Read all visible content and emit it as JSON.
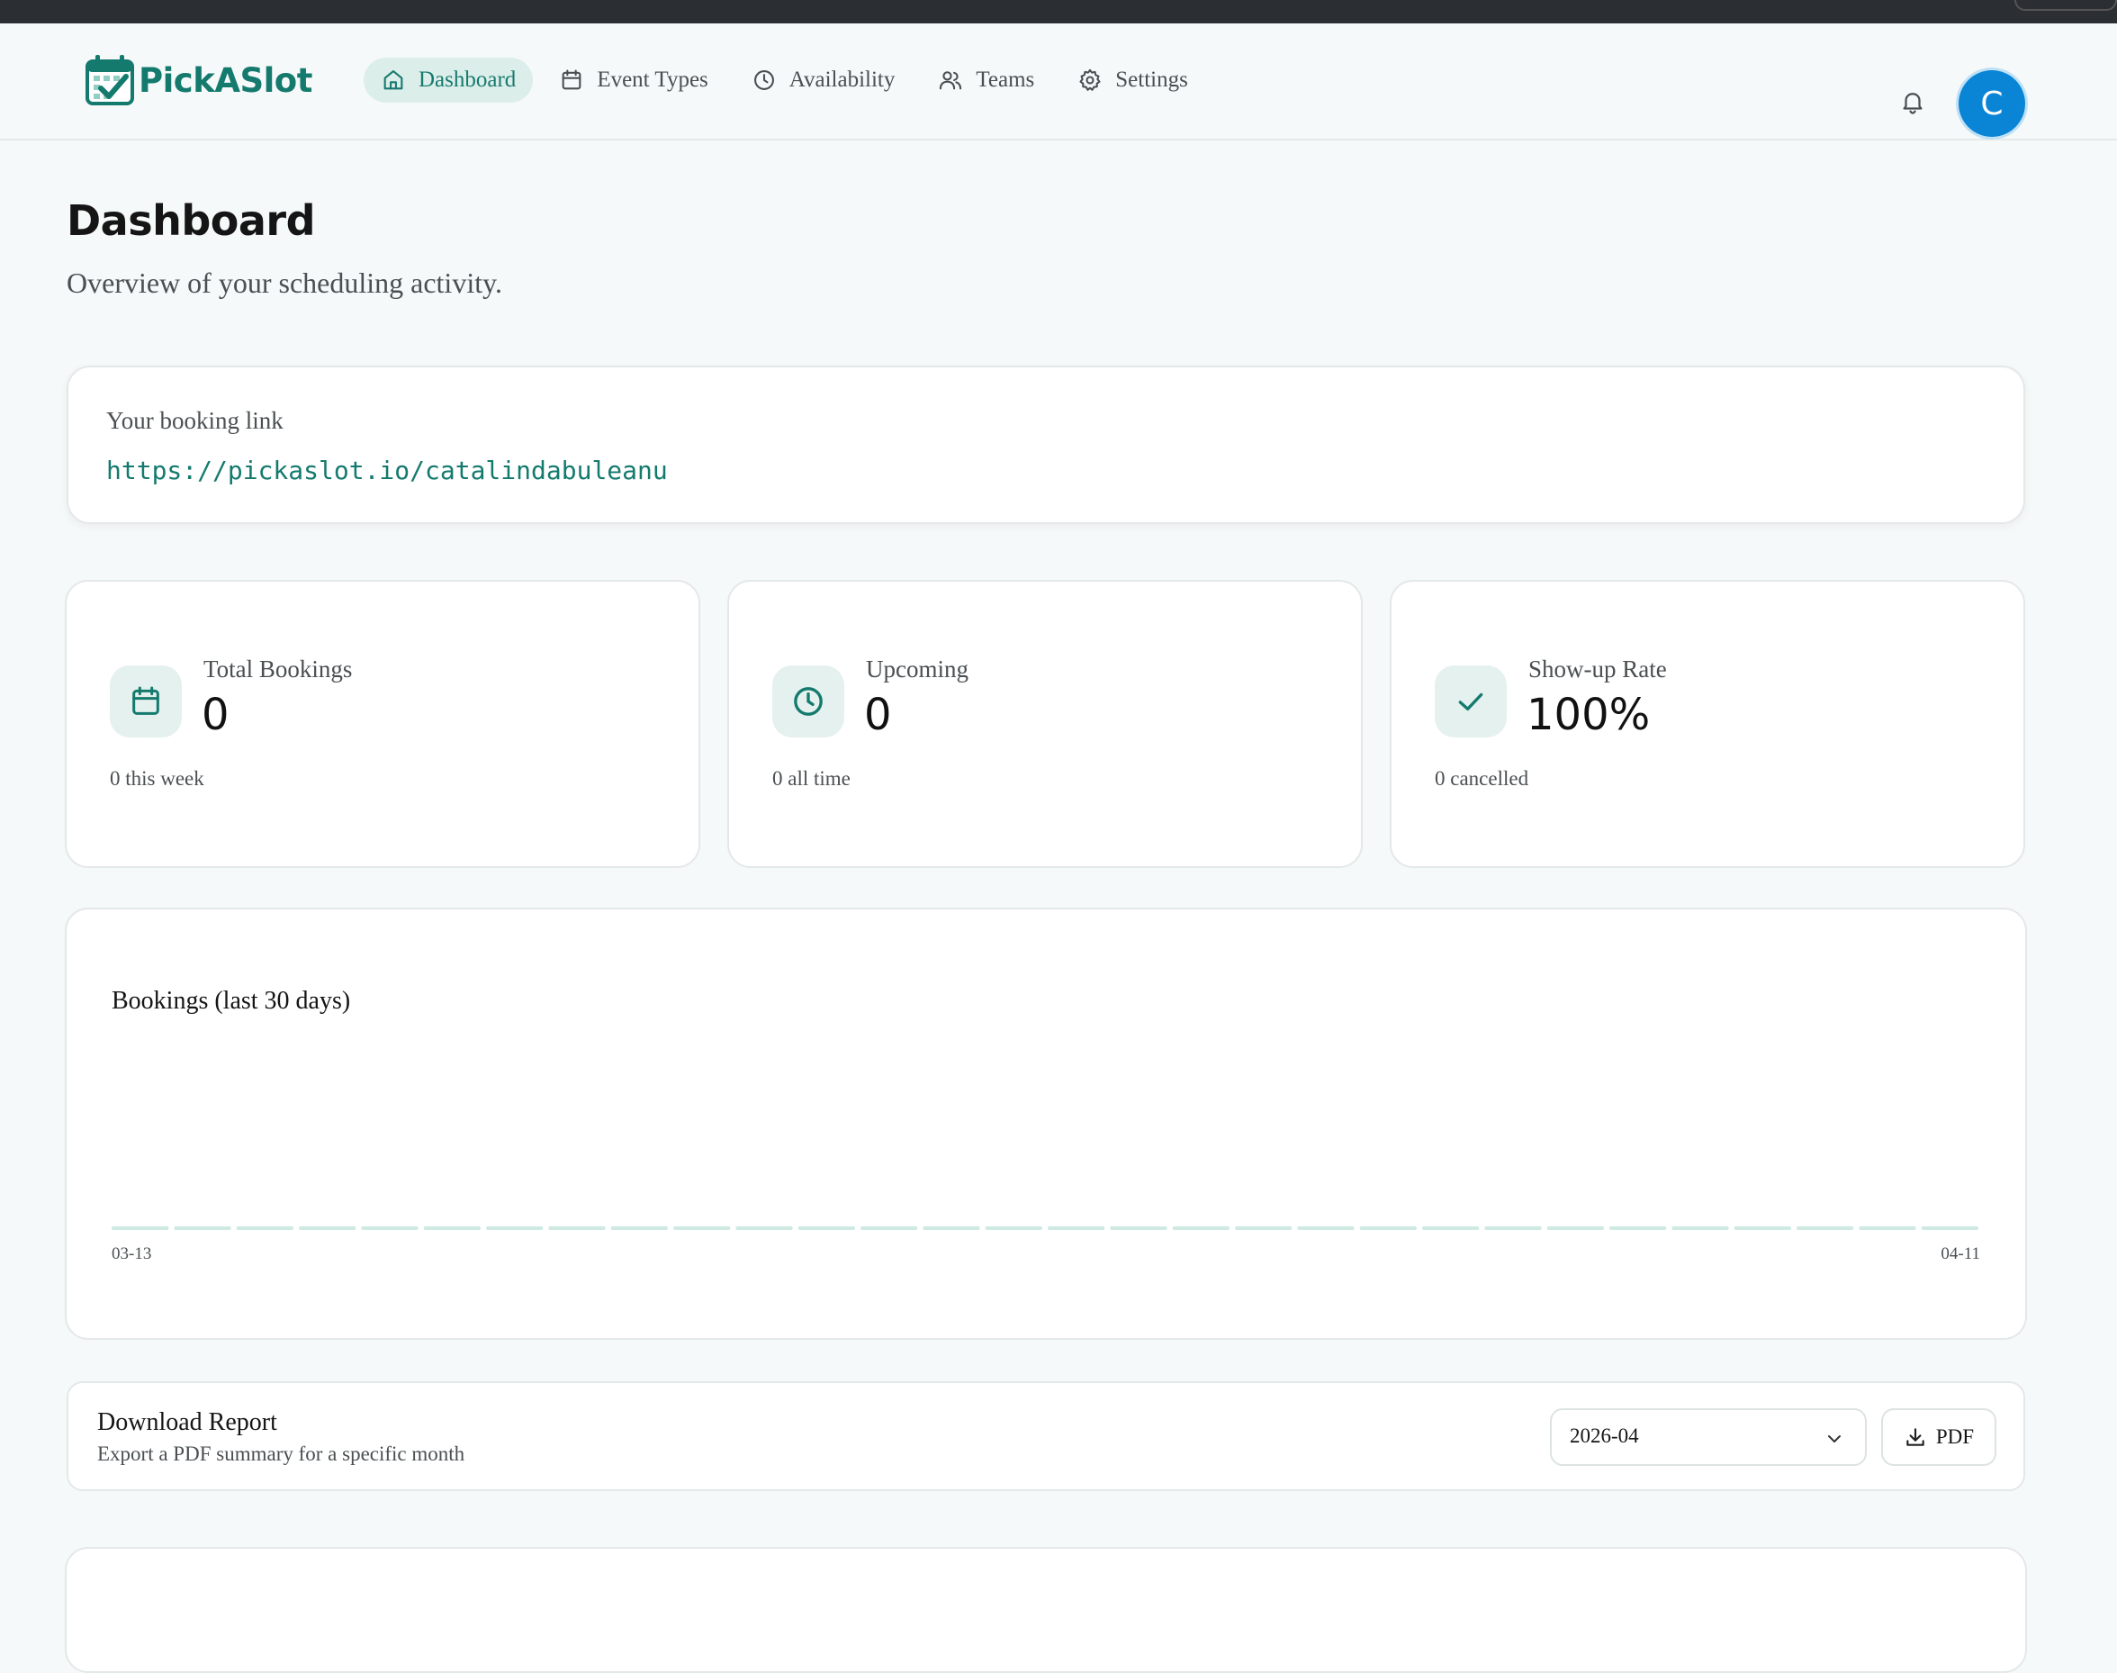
{
  "app": {
    "name": "PickASlot"
  },
  "nav": {
    "items": [
      {
        "label": "Dashboard",
        "icon": "home-icon",
        "active": true
      },
      {
        "label": "Event Types",
        "icon": "calendar-icon",
        "active": false
      },
      {
        "label": "Availability",
        "icon": "clock-icon",
        "active": false
      },
      {
        "label": "Teams",
        "icon": "users-icon",
        "active": false
      },
      {
        "label": "Settings",
        "icon": "gear-icon",
        "active": false
      }
    ]
  },
  "header": {
    "avatar_initial": "C",
    "notifications_icon": "bell-icon"
  },
  "page": {
    "title": "Dashboard",
    "subtitle": "Overview of your scheduling activity."
  },
  "booking_link": {
    "label": "Your booking link",
    "url": "https://pickaslot.io/catalindabuleanu"
  },
  "stats": [
    {
      "label": "Total Bookings",
      "value": "0",
      "sub": "0 this week",
      "icon": "calendar-icon"
    },
    {
      "label": "Upcoming",
      "value": "0",
      "sub": "0 all time",
      "icon": "clock-icon"
    },
    {
      "label": "Show-up Rate",
      "value": "100%",
      "sub": "0 cancelled",
      "icon": "check-icon"
    }
  ],
  "chart_data": {
    "type": "bar",
    "title": "Bookings (last 30 days)",
    "x_start_label": "03-13",
    "x_end_label": "04-11",
    "values": [
      0,
      0,
      0,
      0,
      0,
      0,
      0,
      0,
      0,
      0,
      0,
      0,
      0,
      0,
      0,
      0,
      0,
      0,
      0,
      0,
      0,
      0,
      0,
      0,
      0,
      0,
      0,
      0,
      0,
      0
    ],
    "bar_color": "#cfe9e3",
    "grid": false,
    "legend": "none"
  },
  "report": {
    "title": "Download Report",
    "subtitle": "Export a PDF summary for a specific month",
    "month_value": "2026-04",
    "button_label": "PDF"
  },
  "colors": {
    "accent": "#147a6e",
    "accent_bg": "#dceeea",
    "avatar": "#0a85d6"
  }
}
